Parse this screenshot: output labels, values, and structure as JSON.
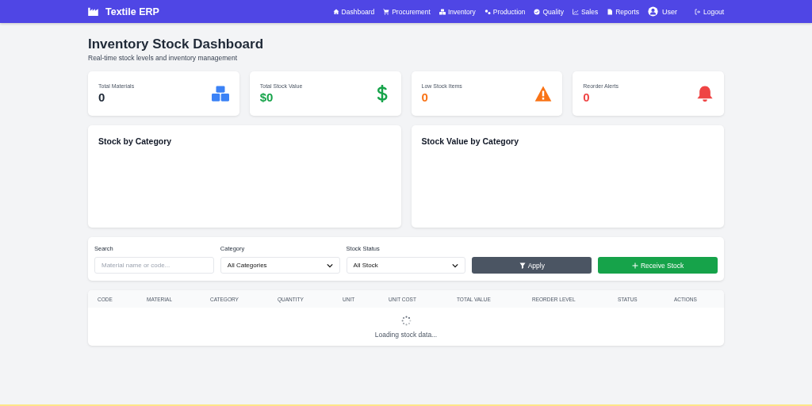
{
  "navbar": {
    "brand": "Textile ERP",
    "links": [
      {
        "label": "Dashboard",
        "kind": "home"
      },
      {
        "label": "Procurement",
        "kind": "cart"
      },
      {
        "label": "Inventory",
        "kind": "boxes"
      },
      {
        "label": "Production",
        "kind": "gears"
      },
      {
        "label": "Quality",
        "kind": "check"
      },
      {
        "label": "Sales",
        "kind": "chart"
      },
      {
        "label": "Reports",
        "kind": "file"
      },
      {
        "label": "User",
        "kind": "user"
      },
      {
        "label": "Logout",
        "kind": "logout"
      }
    ]
  },
  "header": {
    "title": "Inventory Stock Dashboard",
    "subtitle": "Real-time stock levels and inventory management"
  },
  "stats": [
    {
      "label": "Total Materials",
      "value": "0",
      "kind": "boxes",
      "color": "#1f2937"
    },
    {
      "label": "Total Stock Value",
      "value": "$0",
      "kind": "dollar",
      "color": "#16a34a"
    },
    {
      "label": "Low Stock Items",
      "value": "0",
      "kind": "warning",
      "color": "#f97316"
    },
    {
      "label": "Reorder Alerts",
      "value": "0",
      "kind": "bell",
      "color": "#ef4444"
    }
  ],
  "charts": [
    {
      "title": "Stock by Category"
    },
    {
      "title": "Stock Value by Category"
    }
  ],
  "filters": {
    "fields": [
      {
        "kind": "input",
        "label": "Search",
        "placeholder": "Material name or code..."
      },
      {
        "kind": "select",
        "label": "Category",
        "value": "All Categories"
      },
      {
        "kind": "select",
        "label": "Stock Status",
        "value": "All Stock"
      }
    ],
    "buttons": [
      {
        "label": "Apply",
        "kind": "apply"
      },
      {
        "label": "Receive Stock",
        "kind": "receive"
      }
    ]
  },
  "table": {
    "columns": [
      "CODE",
      "MATERIAL",
      "CATEGORY",
      "QUANTITY",
      "UNIT",
      "UNIT COST",
      "TOTAL VALUE",
      "REORDER LEVEL",
      "STATUS",
      "ACTIONS"
    ],
    "loading": "Loading stock data..."
  }
}
